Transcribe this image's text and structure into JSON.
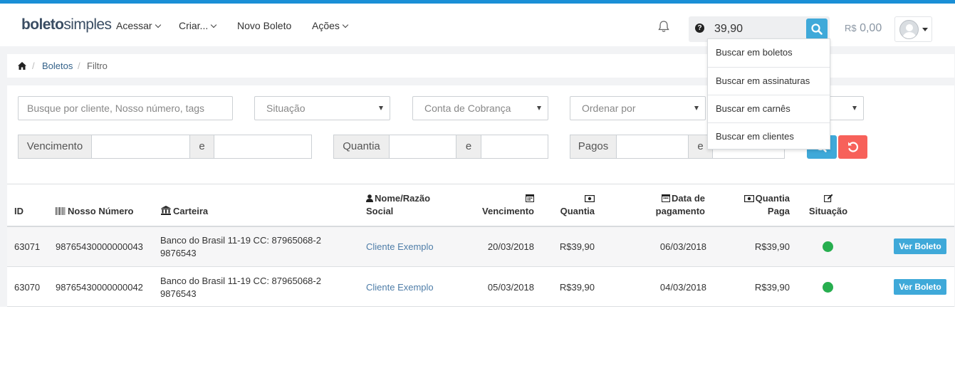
{
  "brand": {
    "logo_part1": "boleto",
    "logo_part2": "simples",
    "accent": "#1a8fd6"
  },
  "nav": [
    {
      "label": "Acessar"
    },
    {
      "label": "Criar..."
    },
    {
      "label": "Novo Boleto"
    },
    {
      "label": "Ações"
    }
  ],
  "search": {
    "value": "39,90",
    "help_icon": "?"
  },
  "balance": {
    "currency": "R$",
    "amount": "0,00"
  },
  "search_menu": [
    "Buscar em boletos",
    "Buscar em assinaturas",
    "Buscar em carnês",
    "Buscar em clientes"
  ],
  "breadcrumb": {
    "sep": "/",
    "link": "Boletos",
    "current": "Filtro"
  },
  "filters": {
    "query_placeholder": "Busque por cliente, Nosso número, tags",
    "situacao": "Situação",
    "conta": "Conta de Cobrança",
    "ordenar": "Ordenar por",
    "vencimento": "Vencimento",
    "quantia": "Quantia",
    "pagos": "Pagos",
    "e": "e"
  },
  "table": {
    "headers": {
      "id": "ID",
      "nosso_numero": "Nosso Número",
      "carteira": "Carteira",
      "nome_1": "Nome/Razão",
      "nome_2": "Social",
      "vencimento": "Vencimento",
      "quantia": "Quantia",
      "data_1": "Data de",
      "data_2": "pagamento",
      "quantia_paga_1": "Quantia",
      "quantia_paga_2": "Paga",
      "situacao": "Situação"
    },
    "rows": [
      {
        "id": "63071",
        "nosso_numero": "98765430000000043",
        "carteira_1": "Banco do Brasil 11-19 CC: 87965068-2",
        "carteira_2": "9876543",
        "cliente": "Cliente Exemplo",
        "vencimento": "20/03/2018",
        "quantia": "R$39,90",
        "data_pagamento": "06/03/2018",
        "quantia_paga": "R$39,90",
        "status_color": "#27ae4f",
        "action": "Ver Boleto"
      },
      {
        "id": "63070",
        "nosso_numero": "98765430000000042",
        "carteira_1": "Banco do Brasil 11-19 CC: 87965068-2",
        "carteira_2": "9876543",
        "cliente": "Cliente Exemplo",
        "vencimento": "05/03/2018",
        "quantia": "R$39,90",
        "data_pagamento": "04/03/2018",
        "quantia_paga": "R$39,90",
        "status_color": "#27ae4f",
        "action": "Ver Boleto"
      }
    ]
  }
}
